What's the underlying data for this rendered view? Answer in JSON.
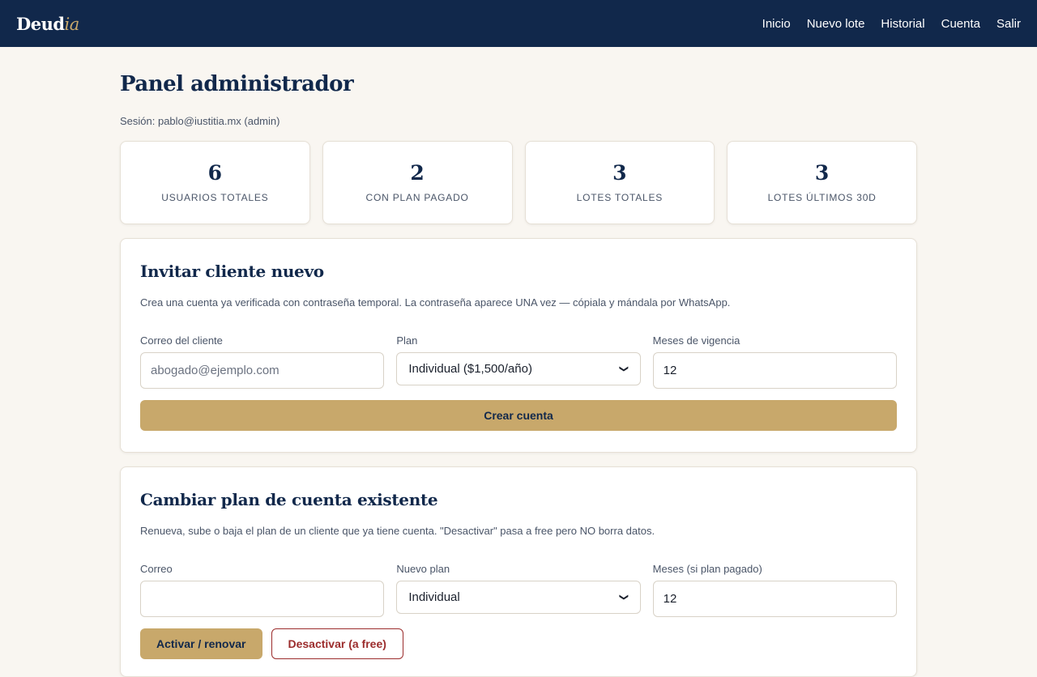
{
  "header": {
    "logo_main": "Deud",
    "logo_accent": "ia",
    "nav": [
      "Inicio",
      "Nuevo lote",
      "Historial",
      "Cuenta",
      "Salir"
    ]
  },
  "page": {
    "title": "Panel administrador",
    "session": "Sesión: pablo@iustitia.mx (admin)"
  },
  "stats": [
    {
      "value": "6",
      "label": "USUARIOS TOTALES"
    },
    {
      "value": "2",
      "label": "CON PLAN PAGADO"
    },
    {
      "value": "3",
      "label": "LOTES TOTALES"
    },
    {
      "value": "3",
      "label": "LOTES ÚLTIMOS 30D"
    }
  ],
  "invite": {
    "title": "Invitar cliente nuevo",
    "description": "Crea una cuenta ya verificada con contraseña temporal. La contraseña aparece UNA vez — cópiala y mándala por WhatsApp.",
    "email_label": "Correo del cliente",
    "email_placeholder": "abogado@ejemplo.com",
    "email_value": "",
    "plan_label": "Plan",
    "plan_value": "Individual ($1,500/año)",
    "months_label": "Meses de vigencia",
    "months_value": "12",
    "submit_label": "Crear cuenta"
  },
  "change_plan": {
    "title": "Cambiar plan de cuenta existente",
    "description": "Renueva, sube o baja el plan de un cliente que ya tiene cuenta. \"Desactivar\" pasa a free pero NO borra datos.",
    "email_label": "Correo",
    "email_value": "",
    "plan_label": "Nuevo plan",
    "plan_value": "Individual",
    "months_label": "Meses (si plan pagado)",
    "months_value": "12",
    "activate_label": "Activar / renovar",
    "deactivate_label": "Desactivar (a free)"
  },
  "colors": {
    "navy": "#11284b",
    "gold": "#c8a86b",
    "danger": "#9b2c2c",
    "background": "#f9f6f1"
  }
}
